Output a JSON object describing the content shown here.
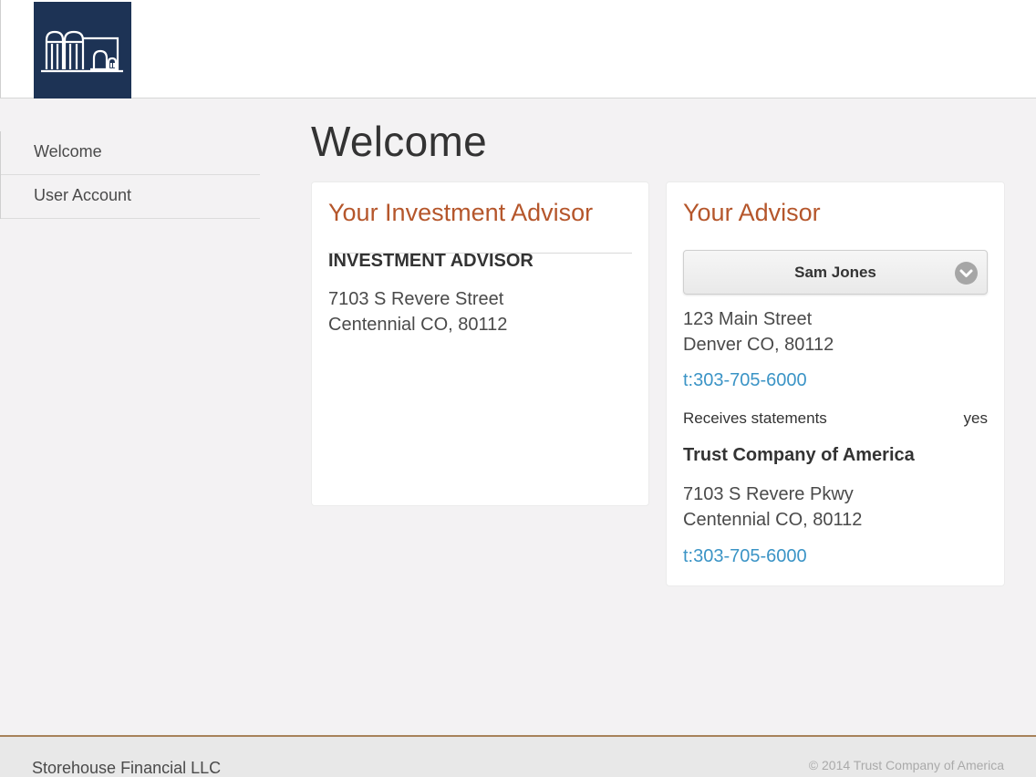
{
  "header": {
    "logo_icon": "storehouse-building-icon",
    "brand_color": "#1d3355"
  },
  "sidebar": {
    "items": [
      {
        "label": "Welcome"
      },
      {
        "label": "User Account"
      }
    ]
  },
  "main": {
    "title": "Welcome",
    "investment_advisor_card": {
      "title": "Your Investment Advisor",
      "name": "INVESTMENT ADVISOR",
      "address_line1": "7103 S Revere Street",
      "address_line2": "Centennial CO, 80112"
    },
    "advisor_card": {
      "title": "Your Advisor",
      "selected_advisor": "Sam Jones",
      "address_line1": "123 Main Street",
      "address_line2": "Denver CO, 80112",
      "phone": "t:303-705-6000",
      "statements_label": "Receives statements",
      "statements_value": "yes",
      "company_name": "Trust Company of America",
      "company_address_line1": "7103 S Revere Pkwy",
      "company_address_line2": "Centennial CO, 80112",
      "company_phone": "t:303-705-6000"
    }
  },
  "footer": {
    "left_text": "Storehouse Financial LLC",
    "right_text": "© 2014 Trust Company of America"
  },
  "colors": {
    "accent_title": "#b5562b",
    "link": "#3b94c6",
    "footer_border": "#a7825a"
  }
}
